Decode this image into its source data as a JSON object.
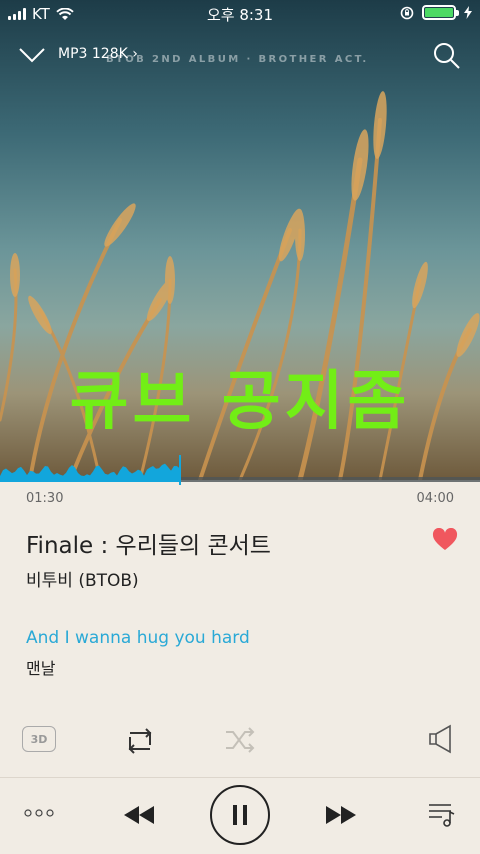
{
  "status_bar": {
    "carrier": "KT",
    "time": "오후 8:31"
  },
  "header": {
    "quality": "MP3 128K",
    "album_caption": "BTOB 2ND ALBUM · BROTHER ACT."
  },
  "overlay_text": "큐브 공지좀",
  "player": {
    "elapsed": "01:30",
    "total": "04:00",
    "progress_fraction": 0.375,
    "title": "Finale : 우리들의 콘서트",
    "artist": "비투비 (BTOB)",
    "liked": true
  },
  "lyrics": {
    "current": "And I wanna hug you hard",
    "next": "맨날"
  },
  "controls": {
    "three_d_label": "3D"
  },
  "colors": {
    "accent": "#2aa9d6",
    "heart": "#f0575e",
    "overlay": "#72ee16",
    "wave": "#12a6dc"
  }
}
